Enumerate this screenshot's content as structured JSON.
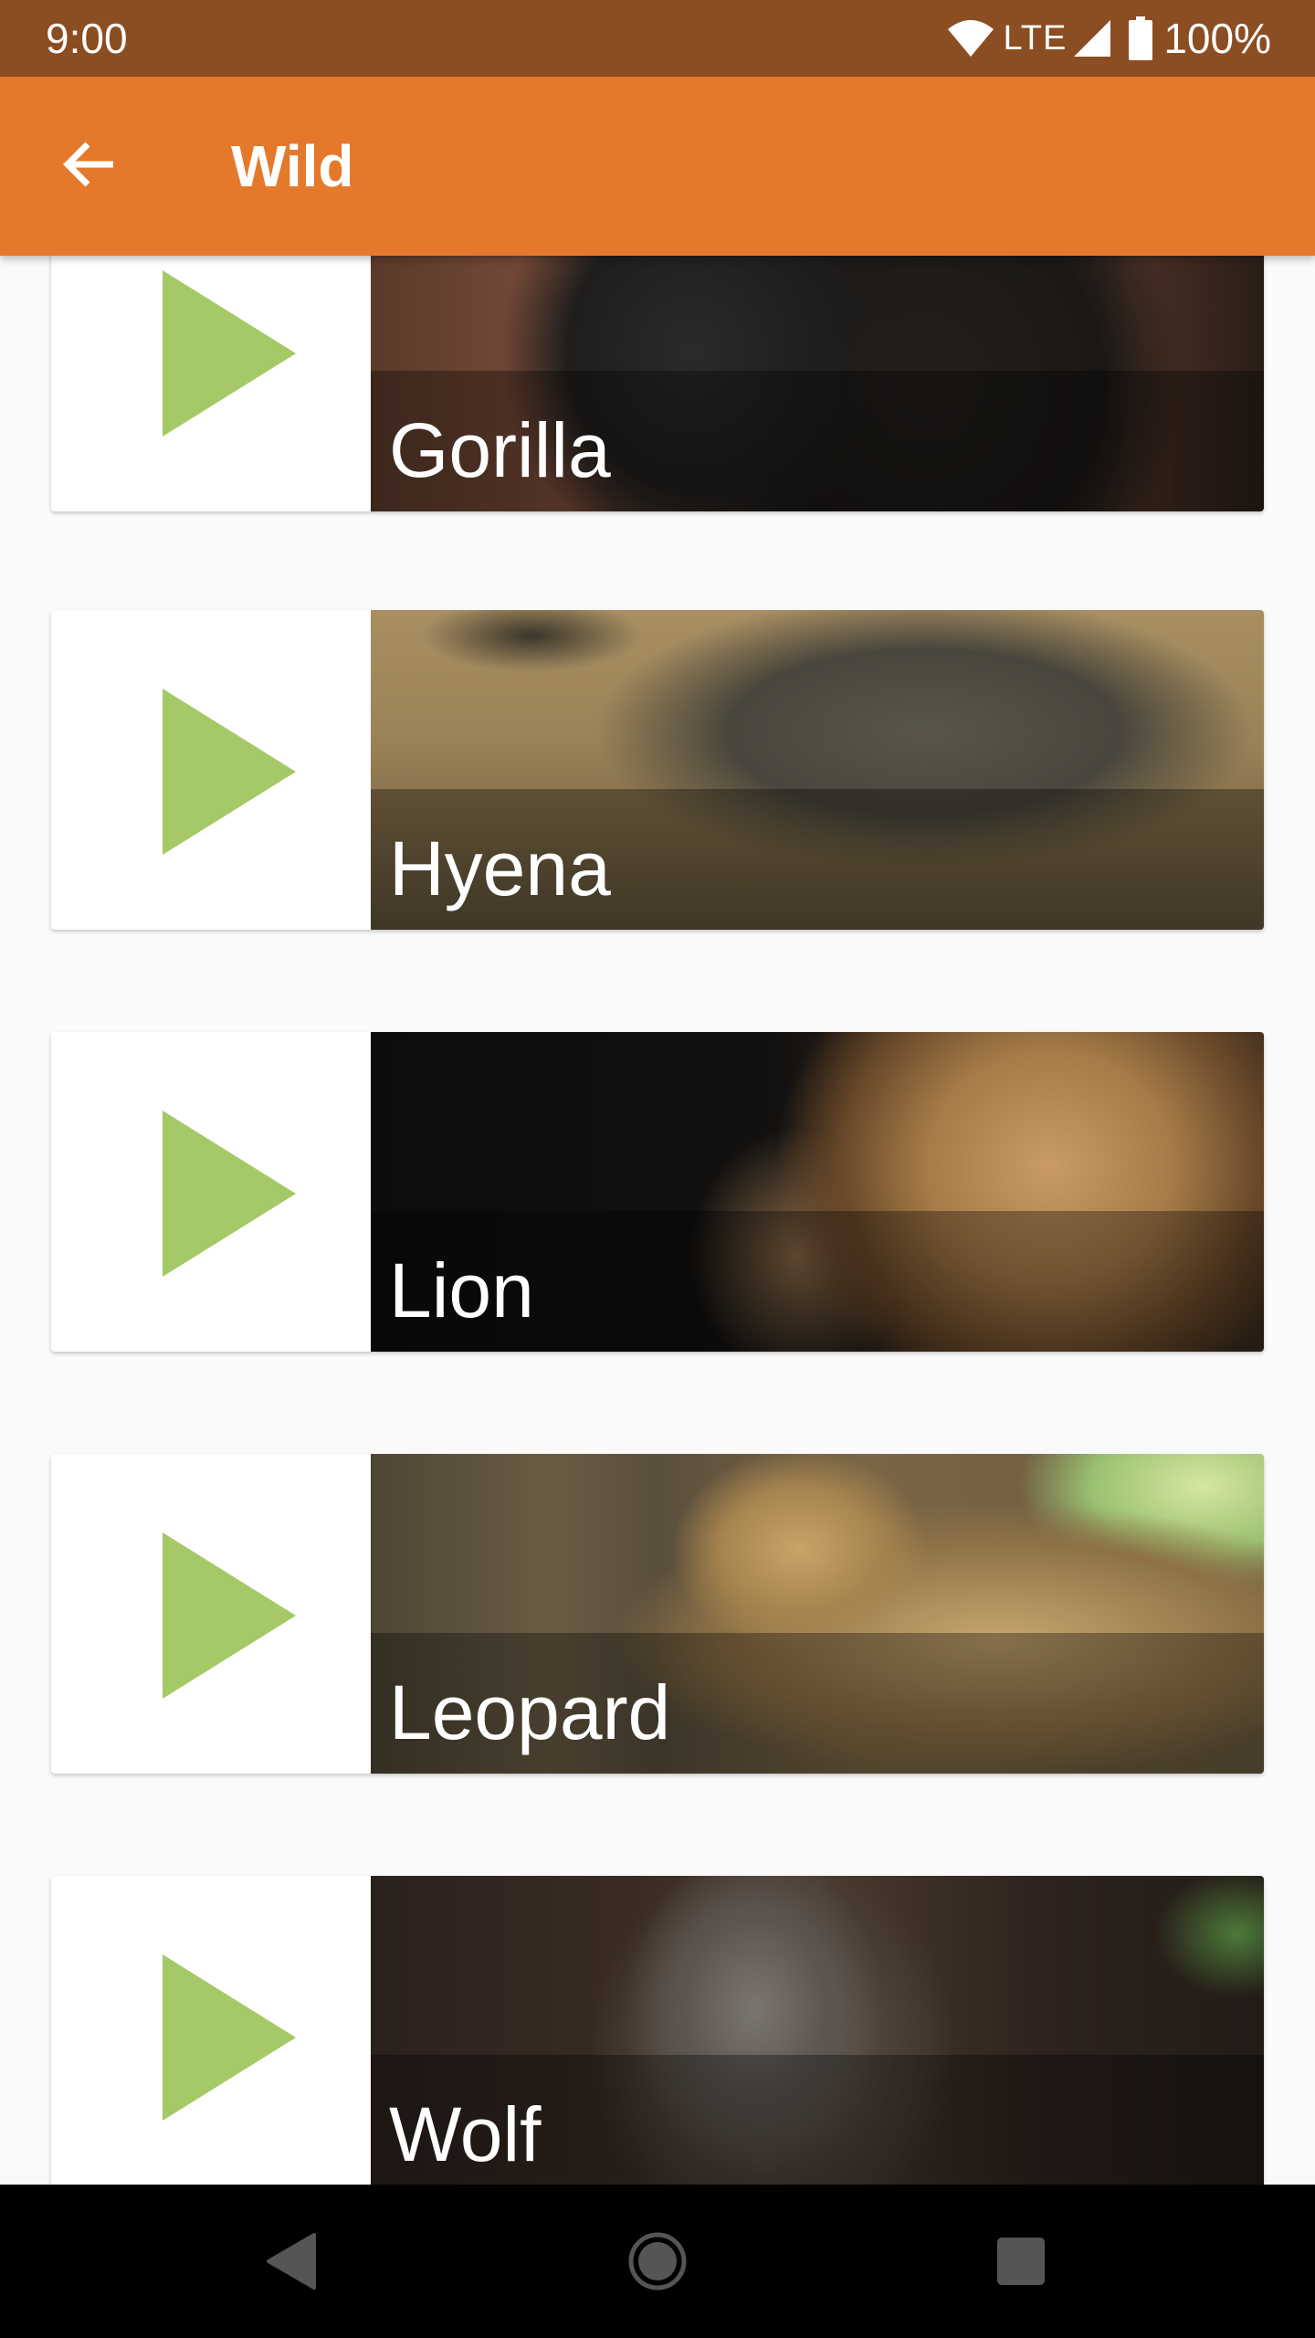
{
  "status_bar": {
    "time": "9:00",
    "network": "LTE",
    "battery": "100%",
    "icons": [
      "wifi-icon",
      "cell-signal-icon",
      "battery-icon"
    ]
  },
  "app_bar": {
    "title": "Wild",
    "back_icon": "arrow-back-icon",
    "color": "#e5792b"
  },
  "animals": [
    {
      "name": "Gorilla",
      "play_icon": "play-icon"
    },
    {
      "name": "Hyena",
      "play_icon": "play-icon"
    },
    {
      "name": "Lion",
      "play_icon": "play-icon"
    },
    {
      "name": "Leopard",
      "play_icon": "play-icon"
    },
    {
      "name": "Wolf",
      "play_icon": "play-icon"
    }
  ],
  "colors": {
    "status_bar": "#8b4d22",
    "app_bar": "#e5792b",
    "play_icon": "#a5c967",
    "background": "#fafafa"
  },
  "nav_bar": {
    "icons": [
      "back-triangle-icon",
      "home-circle-icon",
      "recents-square-icon"
    ]
  }
}
